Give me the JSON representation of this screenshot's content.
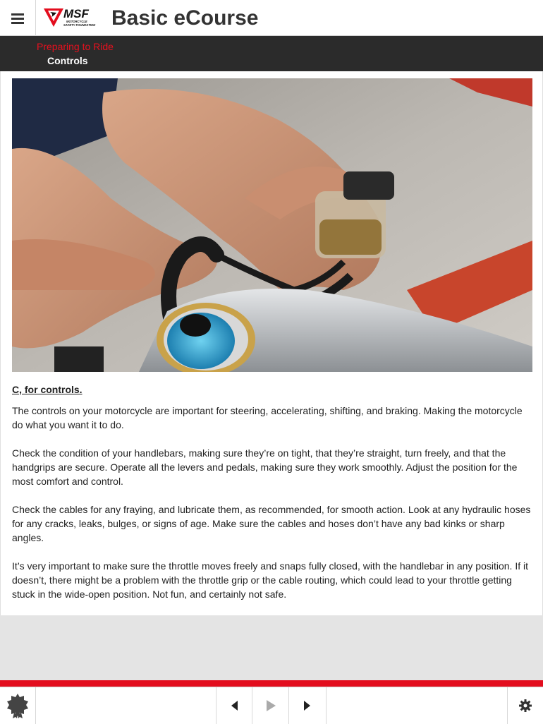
{
  "header": {
    "menu_icon": "hamburger-menu-icon",
    "logo": {
      "brand": "MSF",
      "tagline": "MOTORCYCLE SAFETY FOUNDATION"
    },
    "title": "Basic eCourse"
  },
  "breadcrumb": {
    "section": "Preparing to Ride",
    "page": "Controls"
  },
  "content": {
    "image": {
      "subject": "hands-checking-brake-fluid-reservoir"
    },
    "heading": "C, for controls.",
    "paragraphs": [
      "The controls on your motorcycle are important for steering, accelerating, shifting, and braking. Making the motorcycle do what you want it to do.",
      "Check the condition of your handlebars, making sure they’re on tight, that they’re straight, turn freely, and that the handgrips are secure. Operate all the levers and pedals, making sure they work smoothly. Adjust the position for the most comfort and control.",
      "Check the cables for any fraying, and lubricate them, as recommended, for smooth action. Look at any hydraulic hoses for any cracks, leaks, bulges, or signs of age. Make sure the cables and hoses don’t have any bad kinks or sharp angles.",
      "It’s very important to make sure the throttle moves freely and snaps fully closed, with the handlebar in any position. If it doesn’t, there might be a problem with the throttle grip or the cable routing, which could lead to your throttle getting stuck in the wide-open position. Not fun, and certainly not safe."
    ]
  },
  "footer": {
    "icons": [
      "badge-icon",
      "previous-icon",
      "play-icon",
      "next-icon",
      "settings-icon"
    ]
  },
  "colors": {
    "accent_red": "#e30d1e",
    "breadcrumb_bg": "#2b2b2b",
    "title_text": "#333333"
  }
}
